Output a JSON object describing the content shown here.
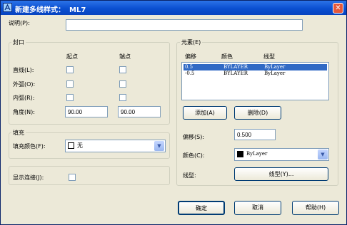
{
  "window": {
    "title": "新建多线样式：",
    "style_name": "ML7",
    "close_glyph": "✕"
  },
  "description": {
    "label": "说明(P):",
    "value": ""
  },
  "caps": {
    "group_title": "封口",
    "col_start": "起点",
    "col_end": "端点",
    "rows": [
      {
        "label": "直线(L):"
      },
      {
        "label": "外弧(O):"
      },
      {
        "label": "内弧(R):"
      },
      {
        "label": "角度(N):",
        "start_value": "90.00",
        "end_value": "90.00"
      }
    ]
  },
  "fill": {
    "group_title": "填充",
    "color_label": "填充颜色(F):",
    "color_value": "无"
  },
  "show_joints": {
    "label": "显示连接(J):"
  },
  "elements": {
    "group_title": "元素(E)",
    "headers": [
      "偏移",
      "颜色",
      "线型"
    ],
    "rows": [
      {
        "offset": "0.5",
        "color": "BYLAYER",
        "linetype": "ByLayer",
        "selected": true
      },
      {
        "offset": "-0.5",
        "color": "BYLAYER",
        "linetype": "ByLayer",
        "selected": false
      }
    ],
    "add_label": "添加(A)",
    "delete_label": "删除(D)",
    "offset_label": "偏移(S):",
    "offset_value": "0.500",
    "color_label": "颜色(C):",
    "color_value": "ByLayer",
    "color_swatch": "#000000",
    "linetype_label": "线型:",
    "linetype_button": "线型(Y)..."
  },
  "footer": {
    "ok_label": "确定",
    "cancel_label": "取消",
    "help_label": "帮助(H)"
  },
  "colors": {
    "title_bar": "#0a4fd0",
    "selection": "#316ac5",
    "dialog_bg": "#ECE9D8"
  }
}
